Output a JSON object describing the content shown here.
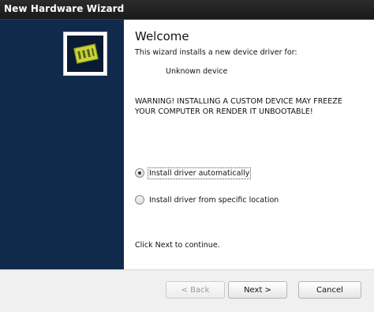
{
  "window": {
    "title": "New Hardware Wizard"
  },
  "content": {
    "heading": "Welcome",
    "intro": "This wizard installs a new device driver for:",
    "device_name": "Unknown device",
    "warning_line1": "WARNING! INSTALLING A CUSTOM DEVICE MAY FREEZE",
    "warning_line2": "YOUR COMPUTER OR RENDER IT UNBOOTABLE!",
    "options": [
      {
        "label": "Install driver automatically",
        "selected": true
      },
      {
        "label": "Install driver from specific location",
        "selected": false
      }
    ],
    "footer_text": "Click Next to continue."
  },
  "buttons": {
    "back": "< Back",
    "next": "Next >",
    "cancel": "Cancel"
  },
  "icons": {
    "wizard_logo": "hardware-chip-icon"
  }
}
